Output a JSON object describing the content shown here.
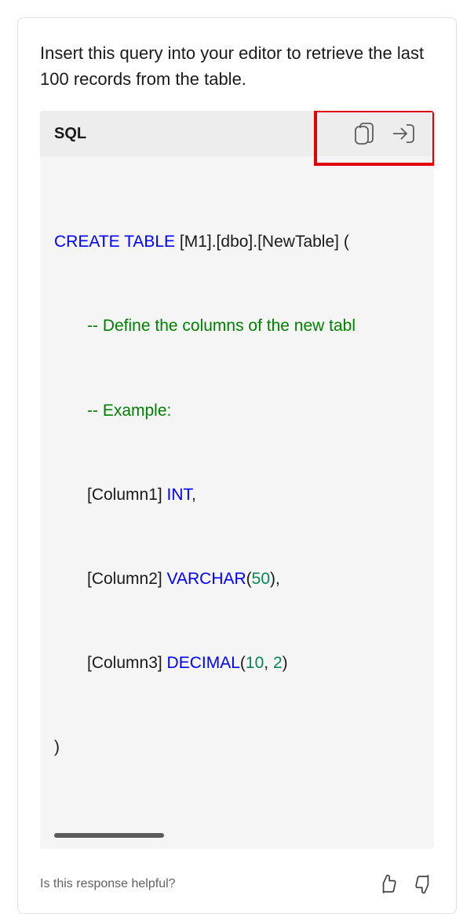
{
  "intro": "Insert this query into your editor to retrieve the last 100 records from the table.",
  "codeHeader": {
    "lang": "SQL"
  },
  "code": {
    "keyword": "CREATE TABLE",
    "ident": " [M1].[dbo].[NewTable] (",
    "comment1": "-- Define the columns of the new tabl",
    "comment2": "-- Example:",
    "col1_name": "[Column1] ",
    "col1_type": "INT",
    "col1_tail": ",",
    "col2_name": "[Column2] ",
    "col2_type": "VARCHAR",
    "col2_open": "(",
    "col2_num": "50",
    "col2_close": "),",
    "col3_name": "[Column3] ",
    "col3_type": "DECIMAL",
    "col3_open": "(",
    "col3_num1": "10",
    "col3_mid": ", ",
    "col3_num2": "2",
    "col3_close": ")",
    "closeParen": ")"
  },
  "feedback": {
    "prompt": "Is this response helpful?"
  }
}
